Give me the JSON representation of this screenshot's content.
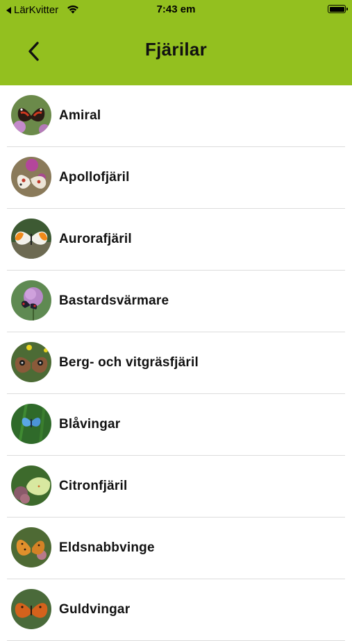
{
  "status_bar": {
    "carrier": "LärKvitter",
    "time": "7:43 em"
  },
  "header": {
    "title": "Fjärilar"
  },
  "colors": {
    "header_bg": "#93c01f",
    "divider": "#dcdcdc"
  },
  "list": {
    "items": [
      {
        "label": "Amiral",
        "icon": "butterfly-thumbnail"
      },
      {
        "label": "Apollofjäril",
        "icon": "butterfly-thumbnail"
      },
      {
        "label": "Aurorafjäril",
        "icon": "butterfly-thumbnail"
      },
      {
        "label": "Bastardsvärmare",
        "icon": "butterfly-thumbnail"
      },
      {
        "label": "Berg- och vitgräsfjäril",
        "icon": "butterfly-thumbnail"
      },
      {
        "label": "Blåvingar",
        "icon": "butterfly-thumbnail"
      },
      {
        "label": "Citronfjäril",
        "icon": "butterfly-thumbnail"
      },
      {
        "label": "Eldsnabbvinge",
        "icon": "butterfly-thumbnail"
      },
      {
        "label": "Guldvingar",
        "icon": "butterfly-thumbnail"
      }
    ]
  }
}
